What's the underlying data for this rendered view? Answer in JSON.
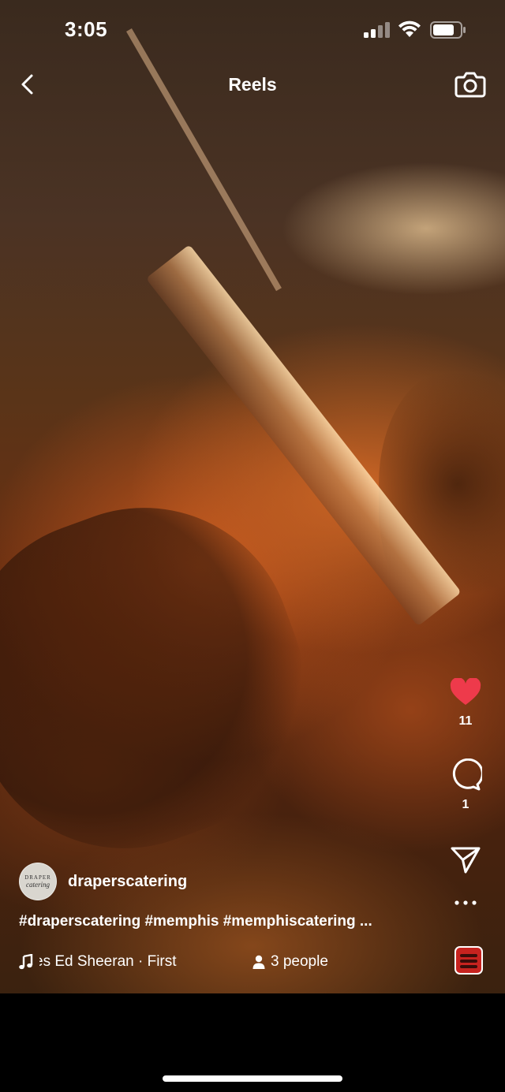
{
  "status_bar": {
    "time": "3:05"
  },
  "header": {
    "title": "Reels"
  },
  "actions": {
    "like_count": "11",
    "comment_count": "1",
    "like_color": "#ee3a4b"
  },
  "post": {
    "username": "draperscatering",
    "avatar_text_1": "DRAPER",
    "avatar_text_2": "catering",
    "caption": "#draperscatering #memphis #memphiscatering ...",
    "audio": "es  Ed Sheeran · First",
    "people": "3 people"
  },
  "icons": [
    "chevron-left",
    "camera",
    "heart",
    "comment",
    "send",
    "more",
    "music-note",
    "person"
  ]
}
